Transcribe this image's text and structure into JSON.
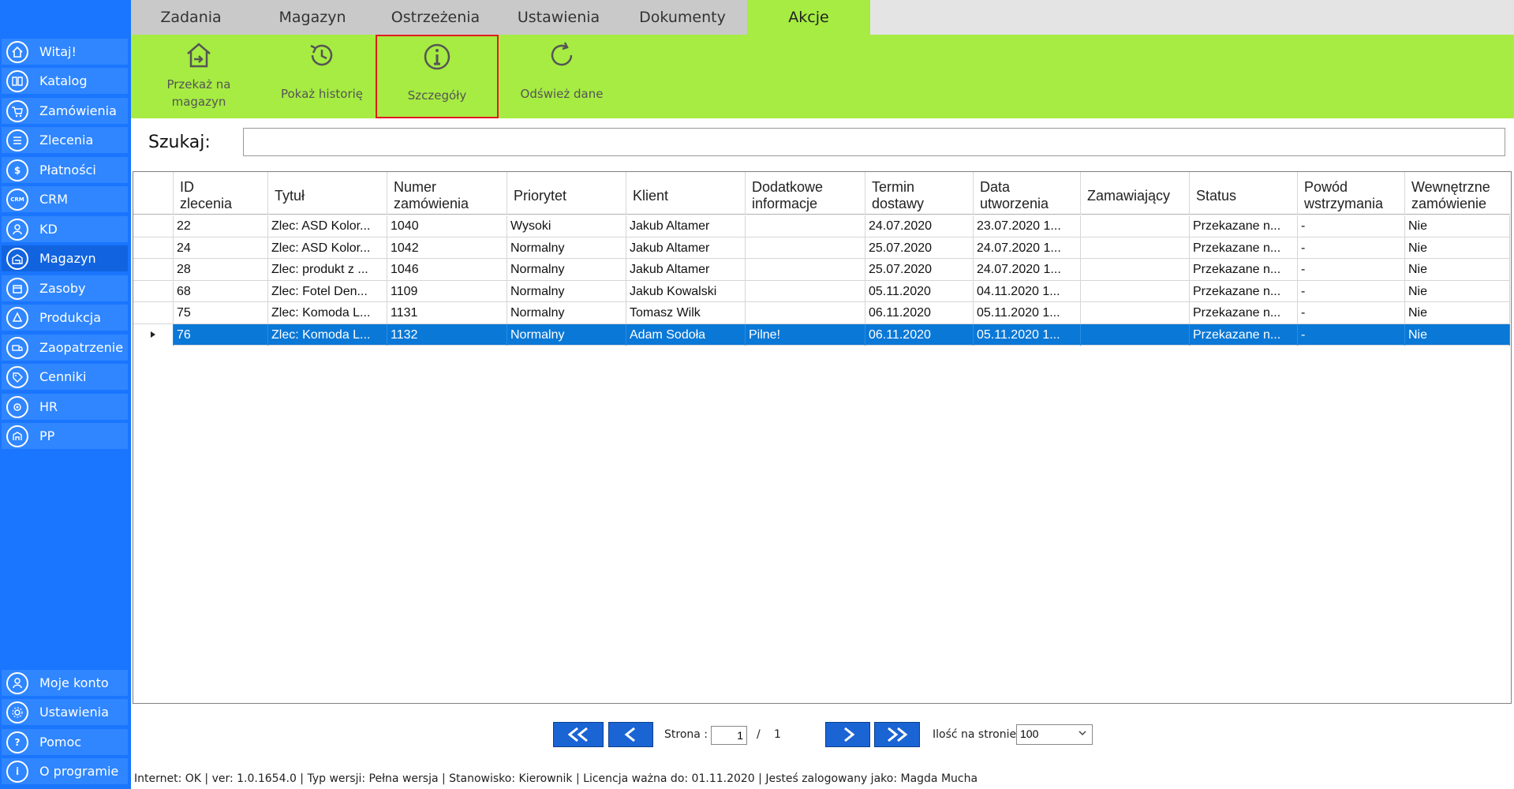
{
  "sidebar": {
    "items": [
      {
        "label": "Witaj!",
        "icon": "home-icon"
      },
      {
        "label": "Katalog",
        "icon": "book-icon"
      },
      {
        "label": "Zamówienia",
        "icon": "cart-icon"
      },
      {
        "label": "Zlecenia",
        "icon": "list-icon"
      },
      {
        "label": "Płatności",
        "icon": "dollar-icon"
      },
      {
        "label": "CRM",
        "icon": "crm-icon"
      },
      {
        "label": "KD",
        "icon": "user-icon"
      },
      {
        "label": "Magazyn",
        "icon": "warehouse-icon"
      },
      {
        "label": "Zasoby",
        "icon": "box-icon"
      },
      {
        "label": "Produkcja",
        "icon": "production-icon"
      },
      {
        "label": "Zaopatrzenie",
        "icon": "supply-icon"
      },
      {
        "label": "Cenniki",
        "icon": "tag-icon"
      },
      {
        "label": "HR",
        "icon": "hr-icon"
      },
      {
        "label": "PP",
        "icon": "pp-icon"
      }
    ],
    "bottom_items": [
      {
        "label": "Moje konto",
        "icon": "account-icon"
      },
      {
        "label": "Ustawienia",
        "icon": "gear-icon"
      },
      {
        "label": "Pomoc",
        "icon": "help-icon"
      },
      {
        "label": "O programie",
        "icon": "info-icon"
      }
    ]
  },
  "tabs": [
    "Zadania",
    "Magazyn",
    "Ostrzeżenia",
    "Ustawienia",
    "Dokumenty",
    "Akcje"
  ],
  "active_tab": "Akcje",
  "ribbon": {
    "buttons": [
      {
        "label_line1": "Przekaż na",
        "label_line2": "magazyn",
        "icon": "transfer-warehouse-icon"
      },
      {
        "label_line1": "Pokaż historię",
        "label_line2": "",
        "icon": "history-icon"
      },
      {
        "label_line1": "Szczegóły",
        "label_line2": "",
        "icon": "info-icon"
      },
      {
        "label_line1": "Odśwież dane",
        "label_line2": "",
        "icon": "refresh-icon"
      }
    ]
  },
  "search": {
    "label": "Szukaj:",
    "value": ""
  },
  "grid": {
    "columns": [
      [
        "ID",
        "zlecenia"
      ],
      [
        "Tytuł",
        ""
      ],
      [
        "Numer",
        "zamówienia"
      ],
      [
        "Priorytet",
        ""
      ],
      [
        "Klient",
        ""
      ],
      [
        "Dodatkowe",
        "informacje"
      ],
      [
        "Termin",
        "dostawy"
      ],
      [
        "Data",
        "utworzenia"
      ],
      [
        "Zamawiający",
        ""
      ],
      [
        "Status",
        ""
      ],
      [
        "Powód",
        "wstrzymania"
      ],
      [
        "Wewnętrzne",
        "zamówienie"
      ]
    ],
    "rows": [
      [
        "22",
        "Zlec: ASD Kolor...",
        "1040",
        "Wysoki",
        "Jakub  Altamer",
        "",
        "24.07.2020",
        "23.07.2020 1...",
        "",
        "Przekazane n...",
        "-",
        "Nie"
      ],
      [
        "24",
        "Zlec: ASD Kolor...",
        "1042",
        "Normalny",
        "Jakub  Altamer",
        "",
        "25.07.2020",
        "24.07.2020 1...",
        "",
        "Przekazane n...",
        "-",
        "Nie"
      ],
      [
        "28",
        "Zlec: produkt z ...",
        "1046",
        "Normalny",
        "Jakub  Altamer",
        "",
        "25.07.2020",
        "24.07.2020 1...",
        "",
        "Przekazane n...",
        "-",
        "Nie"
      ],
      [
        "68",
        "Zlec: Fotel Den...",
        "1109",
        "Normalny",
        "Jakub Kowalski",
        "",
        "05.11.2020",
        "04.11.2020 1...",
        "",
        "Przekazane n...",
        "-",
        "Nie"
      ],
      [
        "75",
        "Zlec: Komoda L...",
        "1131",
        "Normalny",
        "Tomasz Wilk",
        "",
        "06.11.2020",
        "05.11.2020 1...",
        "",
        "Przekazane n...",
        "-",
        "Nie"
      ],
      [
        "76",
        "Zlec: Komoda L...",
        "1132",
        "Normalny",
        "Adam Sodoła",
        "Pilne!",
        "06.11.2020",
        "05.11.2020 1...",
        "",
        "Przekazane n...",
        "-",
        "Nie"
      ]
    ],
    "selected_row_id": "76"
  },
  "pagination": {
    "page_label": "Strona :",
    "page_value": "1",
    "separator": "/",
    "total_pages": "1",
    "per_page_label": "Ilość na stronie:",
    "per_page_value": "100"
  },
  "statusbar": {
    "text": "Internet: OK  |   ver: 1.0.1654.0   |   Typ wersji: Pełna wersja   |   Stanowisko: Kierownik   |   Licencja ważna do: 01.11.2020   |   Jesteś zalogowany jako: Magda Mucha"
  },
  "colors": {
    "sidebar": "#1a75ff",
    "ribbon": "#a6ec42",
    "selected_row": "#0a78d7",
    "highlight_border": "#e01b1b"
  }
}
